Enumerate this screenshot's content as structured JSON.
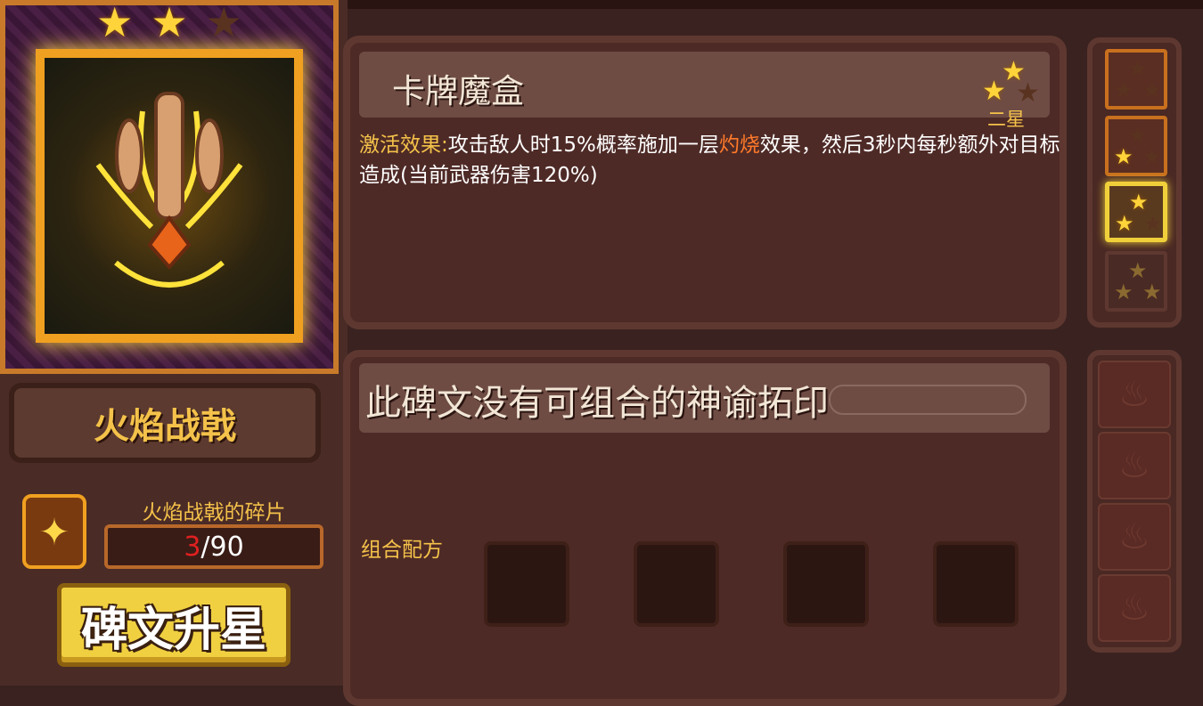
{
  "rune": {
    "name": "火焰战戟",
    "stars": {
      "on": "★",
      "off": "★"
    }
  },
  "shard": {
    "label": "火焰战戟的碎片",
    "current": "3",
    "total": "/90",
    "icon": "flame-halberd-icon"
  },
  "upgrade_button": {
    "label": "碑文升星"
  },
  "card": {
    "title": "卡牌魔盒",
    "grade_label": "二星",
    "effect_label": "激活效果:",
    "effect_part1": "攻击敌人时15%概率施加一层",
    "effect_highlight": "灼烧",
    "effect_part2": "效果，然后3秒内每秒额外对目标造成(当前武器伤害120%)"
  },
  "combo": {
    "title": "此碑文没有可组合的神谕拓印",
    "recipe_label": "组合配方"
  },
  "colors": {
    "gold": "#f4c24a",
    "burn": "#ff7a2a",
    "shard_current": "#e02020",
    "panel": "#4e2a26"
  },
  "tiers": [
    {
      "filled": 0,
      "total": 3
    },
    {
      "filled": 1,
      "total": 3
    },
    {
      "filled": 2,
      "total": 3
    },
    {
      "filled": 3,
      "total": 3
    }
  ]
}
